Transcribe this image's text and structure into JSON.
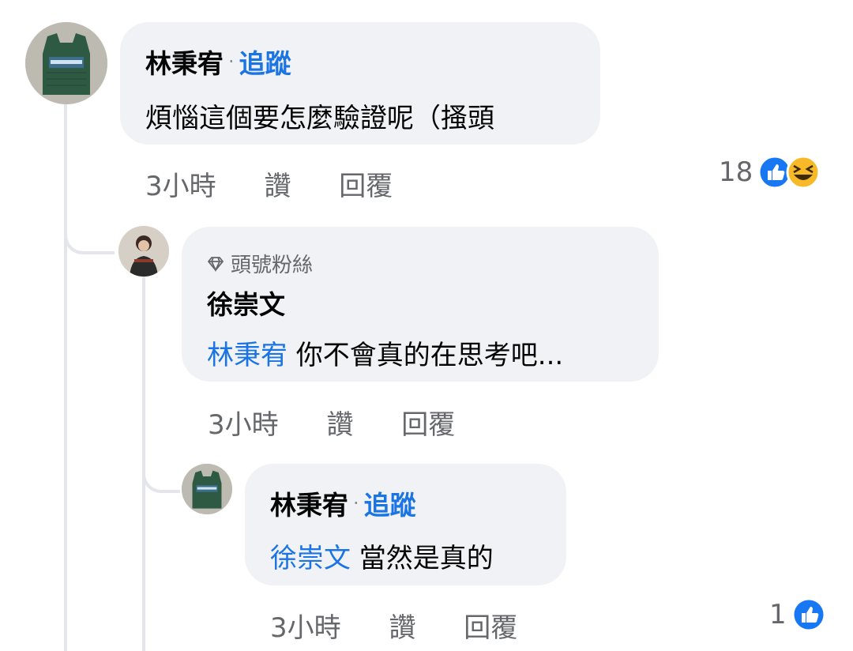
{
  "comments": [
    {
      "author": "林秉宥",
      "follow_label": "追蹤",
      "text": "煩惱這個要怎麼驗證呢（搔頭",
      "time": "3小時",
      "like_label": "讚",
      "reply_label": "回覆",
      "reaction_count": "18"
    },
    {
      "badge": "頭號粉絲",
      "author": "徐崇文",
      "mention": "林秉宥",
      "text": " 你不會真的在思考吧...",
      "time": "3小時",
      "like_label": "讚",
      "reply_label": "回覆"
    },
    {
      "author": "林秉宥",
      "follow_label": "追蹤",
      "mention": "徐崇文",
      "text": " 當然是真的",
      "time": "3小時",
      "like_label": "讚",
      "reply_label": "回覆",
      "reaction_count": "1"
    }
  ],
  "colors": {
    "link": "#1b74e4",
    "bubble": "#f0f2f5",
    "meta": "#65676b",
    "like_blue": "#1877f2",
    "haha_yellow": "#f7b928"
  },
  "icons": [
    "diamond-icon",
    "like-reaction-icon",
    "haha-reaction-icon",
    "vest-avatar-icon"
  ]
}
